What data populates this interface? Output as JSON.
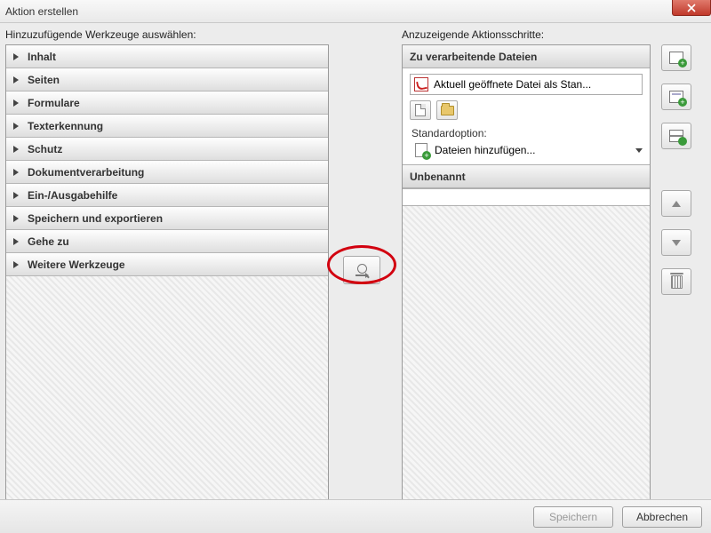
{
  "window": {
    "title": "Aktion erstellen"
  },
  "left": {
    "label": "Hinzuzufügende Werkzeuge auswählen:",
    "items": [
      "Inhalt",
      "Seiten",
      "Formulare",
      "Texterkennung",
      "Schutz",
      "Dokumentverarbeitung",
      "Ein-/Ausgabehilfe",
      "Speichern und exportieren",
      "Gehe zu",
      "Weitere Werkzeuge"
    ]
  },
  "right": {
    "label": "Anzuzeigende Aktionsschritte:",
    "files_header": "Zu verarbeitende Dateien",
    "current_file": "Aktuell geöffnete Datei als Stan...",
    "standard_option_label": "Standardoption:",
    "add_files": "Dateien hinzufügen...",
    "unnamed_header": "Unbenannt"
  },
  "footer": {
    "save": "Speichern",
    "cancel": "Abbrechen"
  }
}
